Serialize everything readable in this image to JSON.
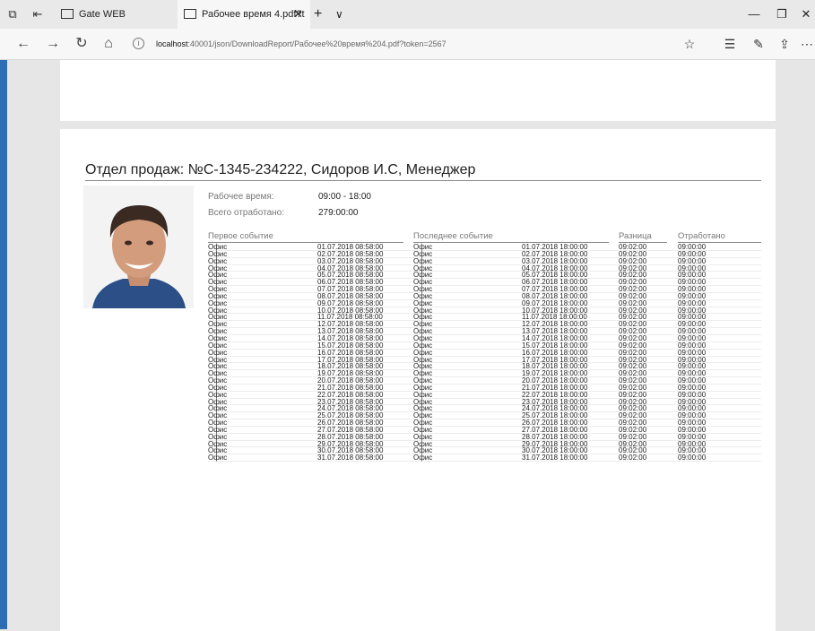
{
  "browser": {
    "tabs": [
      {
        "label": "Gate WEB"
      },
      {
        "label": "Рабочее время 4.pdf?t"
      }
    ],
    "url_host": "localhost",
    "url_rest": ":40001/json/DownloadReport/Рабочее%20время%204.pdf?token=2567"
  },
  "report": {
    "title": "Отдел продаж: №С-1345-234222, Сидоров И.С, Менеджер",
    "work_time_label": "Рабочее время:",
    "work_time_value": "09:00 - 18:00",
    "total_label": "Всего отработано:",
    "total_value": "279:00:00",
    "columns": [
      "Первое событие",
      "Последнее событие",
      "Разница",
      "Отработано"
    ],
    "rows": [
      [
        "Офис",
        "01.07.2018 08:58:00",
        "Офис",
        "01.07.2018 18:00:00",
        "09:02:00",
        "09:00:00"
      ],
      [
        "Офис",
        "02.07.2018 08:58:00",
        "Офис",
        "02.07.2018 18:00:00",
        "09:02:00",
        "09:00:00"
      ],
      [
        "Офис",
        "03.07.2018 08:58:00",
        "Офис",
        "03.07.2018 18:00:00",
        "09:02:00",
        "09:00:00"
      ],
      [
        "Офис",
        "04.07.2018 08:58:00",
        "Офис",
        "04.07.2018 18:00:00",
        "09:02:00",
        "09:00:00"
      ],
      [
        "Офис",
        "05.07.2018 08:58:00",
        "Офис",
        "05.07.2018 18:00:00",
        "09:02:00",
        "09:00:00"
      ],
      [
        "Офис",
        "06.07.2018 08:58:00",
        "Офис",
        "06.07.2018 18:00:00",
        "09:02:00",
        "09:00:00"
      ],
      [
        "Офис",
        "07.07.2018 08:58:00",
        "Офис",
        "07.07.2018 18:00:00",
        "09:02:00",
        "09:00:00"
      ],
      [
        "Офис",
        "08.07.2018 08:58:00",
        "Офис",
        "08.07.2018 18:00:00",
        "09:02:00",
        "09:00:00"
      ],
      [
        "Офис",
        "09.07.2018 08:58:00",
        "Офис",
        "09.07.2018 18:00:00",
        "09:02:00",
        "09:00:00"
      ],
      [
        "Офис",
        "10.07.2018 08:58:00",
        "Офис",
        "10.07.2018 18:00:00",
        "09:02:00",
        "09:00:00"
      ],
      [
        "Офис",
        "11.07.2018 08:58:00",
        "Офис",
        "11.07.2018 18:00:00",
        "09:02:00",
        "09:00:00"
      ],
      [
        "Офис",
        "12.07.2018 08:58:00",
        "Офис",
        "12.07.2018 18:00:00",
        "09:02:00",
        "09:00:00"
      ],
      [
        "Офис",
        "13.07.2018 08:58:00",
        "Офис",
        "13.07.2018 18:00:00",
        "09:02:00",
        "09:00:00"
      ],
      [
        "Офис",
        "14.07.2018 08:58:00",
        "Офис",
        "14.07.2018 18:00:00",
        "09:02:00",
        "09:00:00"
      ],
      [
        "Офис",
        "15.07.2018 08:58:00",
        "Офис",
        "15.07.2018 18:00:00",
        "09:02:00",
        "09:00:00"
      ],
      [
        "Офис",
        "16.07.2018 08:58:00",
        "Офис",
        "16.07.2018 18:00:00",
        "09:02:00",
        "09:00:00"
      ],
      [
        "Офис",
        "17.07.2018 08:58:00",
        "Офис",
        "17.07.2018 18:00:00",
        "09:02:00",
        "09:00:00"
      ],
      [
        "Офис",
        "18.07.2018 08:58:00",
        "Офис",
        "18.07.2018 18:00:00",
        "09:02:00",
        "09:00:00"
      ],
      [
        "Офис",
        "19.07.2018 08:58:00",
        "Офис",
        "19.07.2018 18:00:00",
        "09:02:00",
        "09:00:00"
      ],
      [
        "Офис",
        "20.07.2018 08:58:00",
        "Офис",
        "20.07.2018 18:00:00",
        "09:02:00",
        "09:00:00"
      ],
      [
        "Офис",
        "21.07.2018 08:58:00",
        "Офис",
        "21.07.2018 18:00:00",
        "09:02:00",
        "09:00:00"
      ],
      [
        "Офис",
        "22.07.2018 08:58:00",
        "Офис",
        "22.07.2018 18:00:00",
        "09:02:00",
        "09:00:00"
      ],
      [
        "Офис",
        "23.07.2018 08:58:00",
        "Офис",
        "23.07.2018 18:00:00",
        "09:02:00",
        "09:00:00"
      ],
      [
        "Офис",
        "24.07.2018 08:58:00",
        "Офис",
        "24.07.2018 18:00:00",
        "09:02:00",
        "09:00:00"
      ],
      [
        "Офис",
        "25.07.2018 08:58:00",
        "Офис",
        "25.07.2018 18:00:00",
        "09:02:00",
        "09:00:00"
      ],
      [
        "Офис",
        "26.07.2018 08:58:00",
        "Офис",
        "26.07.2018 18:00:00",
        "09:02:00",
        "09:00:00"
      ],
      [
        "Офис",
        "27.07.2018 08:58:00",
        "Офис",
        "27.07.2018 18:00:00",
        "09:02:00",
        "09:00:00"
      ],
      [
        "Офис",
        "28.07.2018 08:58:00",
        "Офис",
        "28.07.2018 18:00:00",
        "09:02:00",
        "09:00:00"
      ],
      [
        "Офис",
        "29.07.2018 08:58:00",
        "Офис",
        "29.07.2018 18:00:00",
        "09:02:00",
        "09:00:00"
      ],
      [
        "Офис",
        "30.07.2018 08:58:00",
        "Офис",
        "30.07.2018 18:00:00",
        "09:02:00",
        "09:00:00"
      ],
      [
        "Офис",
        "31.07.2018 08:58:00",
        "Офис",
        "31.07.2018 18:00:00",
        "09:02:00",
        "09:00:00"
      ]
    ]
  },
  "colors": {
    "accent": "#2d6db5",
    "page_bg": "#e6e6e6"
  }
}
